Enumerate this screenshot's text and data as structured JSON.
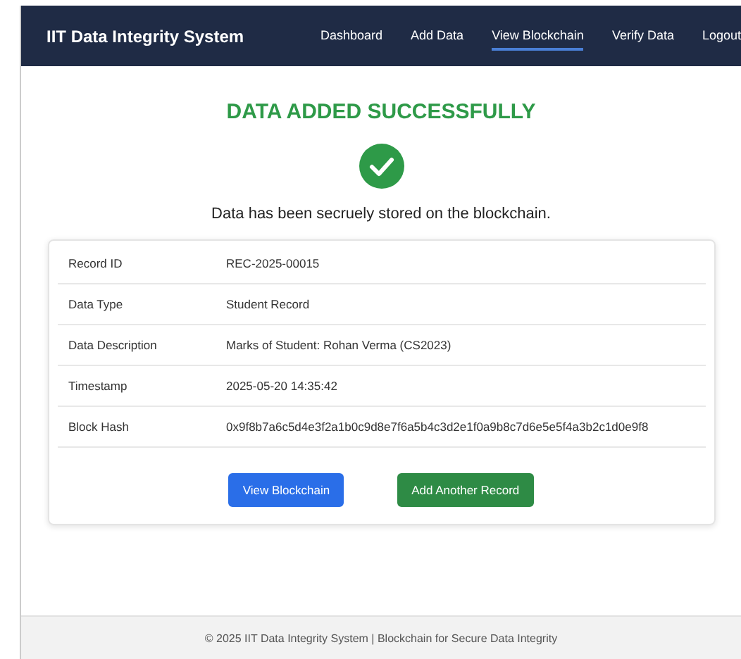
{
  "navbar": {
    "brand": "IIT Data Integrity System",
    "links": [
      {
        "label": "Dashboard",
        "selected": false
      },
      {
        "label": "Add Data",
        "selected": false
      },
      {
        "label": "View Blockchain",
        "selected": true
      },
      {
        "label": "Verify Data",
        "selected": false
      },
      {
        "label": "Logout",
        "selected": false
      }
    ]
  },
  "heading": "DATA ADDED SUCCESSFULLY",
  "message": "Data has been secruely stored on the blockchain.",
  "details": [
    {
      "label": "Record ID",
      "value": "REC-2025-00015"
    },
    {
      "label": "Data Type",
      "value": "Student Record"
    },
    {
      "label": "Data Description",
      "value": "Marks of Student: Rohan Verma (CS2023)"
    },
    {
      "label": "Timestamp",
      "value": "2025-05-20 14:35:42"
    },
    {
      "label": "Block Hash",
      "value": "0x9f8b7a6c5d4e3f2a1b0c9d8e7f6a5b4c3d2e1f0a9b8c7d6e5e5f4a3b2c1d0e9f8"
    }
  ],
  "buttons": [
    {
      "label": "View Blockchain",
      "kind": "primary"
    },
    {
      "label": "Add Another Record",
      "kind": "success"
    }
  ],
  "footer": "© 2025 IIT Data Integrity System | Blockchain for Secure Data Integrity"
}
